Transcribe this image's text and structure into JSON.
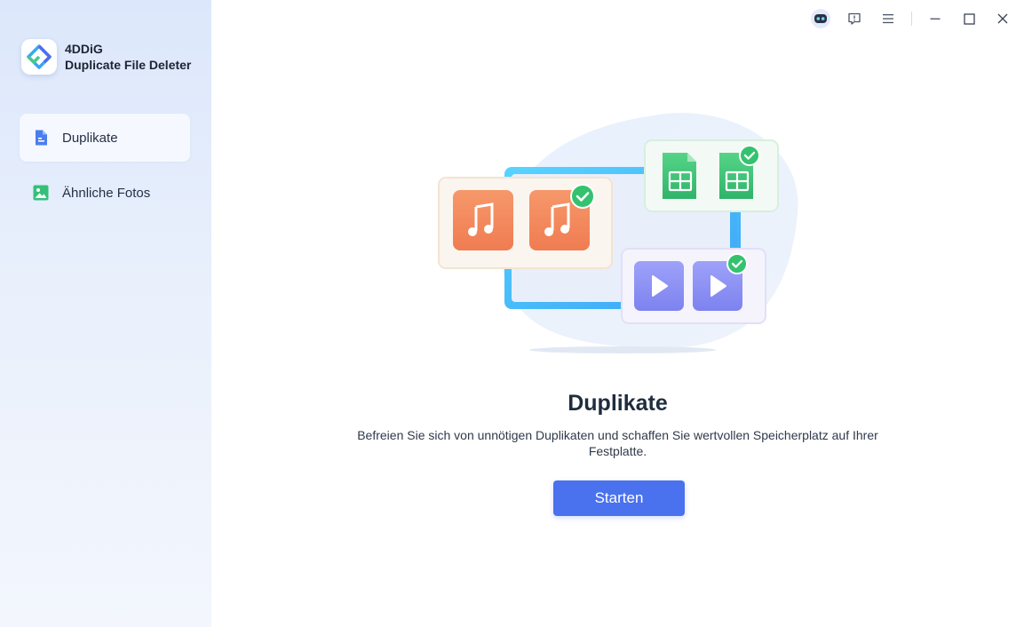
{
  "app": {
    "name": "4DDiG",
    "subtitle": "Duplicate File Deleter"
  },
  "sidebar": {
    "items": [
      {
        "label": "Duplikate",
        "icon": "document-icon",
        "active": true
      },
      {
        "label": "Ähnliche Fotos",
        "icon": "image-icon",
        "active": false
      }
    ]
  },
  "titlebar": {
    "icons": [
      "assistant-robot-icon",
      "feedback-icon",
      "menu-icon",
      "minimize-icon",
      "maximize-icon",
      "close-icon"
    ]
  },
  "main": {
    "title": "Duplikate",
    "description": "Befreien Sie sich von unnötigen Duplikaten und schaffen Sie wertvollen Speicherplatz auf Ihrer Festplatte.",
    "start_label": "Starten"
  },
  "colors": {
    "accent": "#4a72ee",
    "music_orange": "#f3875c",
    "sheet_green": "#3fc071",
    "video_purple": "#8b8ff5",
    "check_green": "#34c26f"
  }
}
